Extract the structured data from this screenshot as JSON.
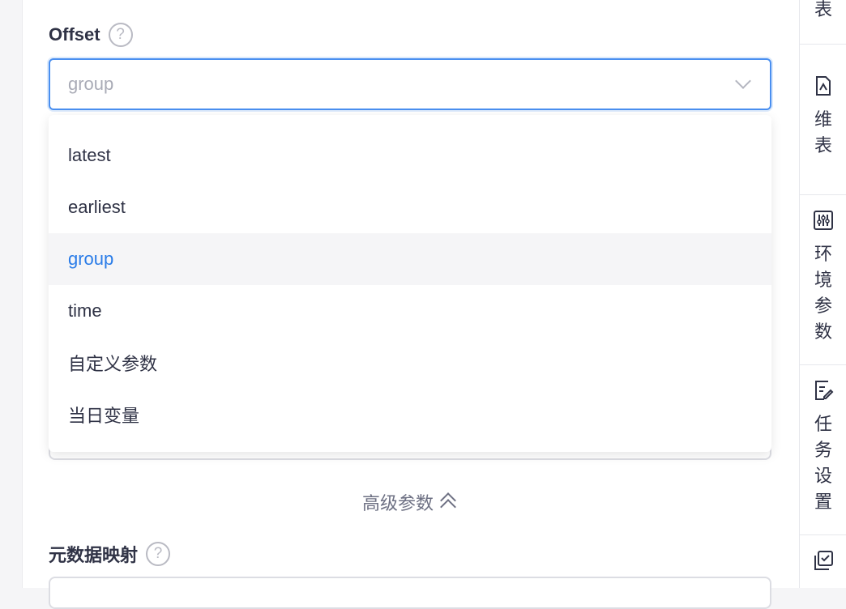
{
  "form": {
    "offset_label": "Offset",
    "offset_help": "?",
    "offset_value": "group",
    "options": [
      "latest",
      "earliest",
      "group",
      "time",
      "自定义参数",
      "当日变量"
    ],
    "selected_option": "group",
    "advanced_toggle": "高级参数",
    "metadata_label": "元数据映射",
    "metadata_help": "?"
  },
  "sidebar": {
    "items": [
      {
        "label": "表",
        "icon": "table-icon"
      },
      {
        "label": "维表",
        "icon": "dimension-table-icon"
      },
      {
        "label": "环境参数",
        "icon": "sliders-icon"
      },
      {
        "label": "任务设置",
        "icon": "edit-task-icon"
      },
      {
        "label": "",
        "icon": "checkbox-copy-icon"
      }
    ]
  },
  "colors": {
    "accent": "#2a7ce8",
    "text": "#2f3245",
    "placeholder": "#a9abb6"
  }
}
